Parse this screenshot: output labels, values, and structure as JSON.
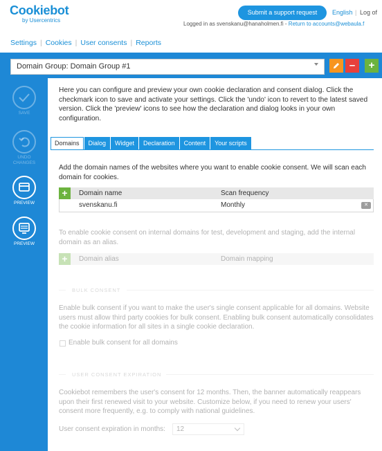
{
  "header": {
    "logo_main": "Cookiebot",
    "logo_sub": "by Usercentrics",
    "support_button": "Submit a support request",
    "language": "English",
    "separator": "|",
    "logout": "Log of",
    "logged_in_prefix": "Logged in as svenskanu@hanaholmen.fi -",
    "return_link": "Return to accounts@webaula.f"
  },
  "nav": {
    "items": [
      "Settings",
      "Cookies",
      "User consents",
      "Reports"
    ],
    "divider": "|"
  },
  "group": {
    "selected": "Domain Group: Domain Group #1",
    "edit_icon": "pencil-icon",
    "remove_label": "–",
    "add_label": "+"
  },
  "sidebar": {
    "save": "SAVE",
    "undo_line1": "UNDO",
    "undo_line2": "CHANGES",
    "preview1": "PREVIEW",
    "preview2": "PREVIEW"
  },
  "intro": "Here you can configure and preview your own cookie declaration and consent dialog. Click the checkmark icon to save and activate your settings. Click the 'undo' icon to revert to the latest saved version. Click the 'preview' icons to see how the declaration and dialog looks in your own configuration.",
  "tabs": [
    "Domains",
    "Dialog",
    "Widget",
    "Declaration",
    "Content",
    "Your scripts"
  ],
  "domains": {
    "description": "Add the domain names of the websites where you want to enable cookie consent. We will scan each domain for cookies.",
    "add_label": "+",
    "col_name": "Domain name",
    "col_freq": "Scan frequency",
    "rows": [
      {
        "name": "svenskanu.fi",
        "frequency": "Monthly",
        "delete_label": "✕"
      }
    ]
  },
  "alias": {
    "description": "To enable cookie consent on internal domains for test, development and staging, add the internal domain as an alias.",
    "add_label": "+",
    "col_alias": "Domain alias",
    "col_mapping": "Domain mapping"
  },
  "bulk": {
    "title": "BULK CONSENT",
    "description": "Enable bulk consent if you want to make the user's single consent applicable for all domains. Website users must allow third party cookies for bulk consent. Enabling bulk consent automatically consolidates the cookie information for all sites in a single cookie declaration.",
    "checkbox_label": "Enable bulk consent for all domains",
    "checked": false
  },
  "expiration": {
    "title": "USER CONSENT EXPIRATION",
    "description": "Cookiebot remembers the user's consent for 12 months. Then, the banner automatically reappears upon their first renewed visit to your website. Customize below, if you need to renew your users' consent more frequently, e.g. to comply with national guidelines.",
    "label": "User consent expiration in months:",
    "value": "12"
  },
  "colors": {
    "brand_blue": "#1e88d6",
    "add_green": "#6cb33f",
    "edit_orange": "#f79520",
    "remove_red": "#e8403c"
  }
}
